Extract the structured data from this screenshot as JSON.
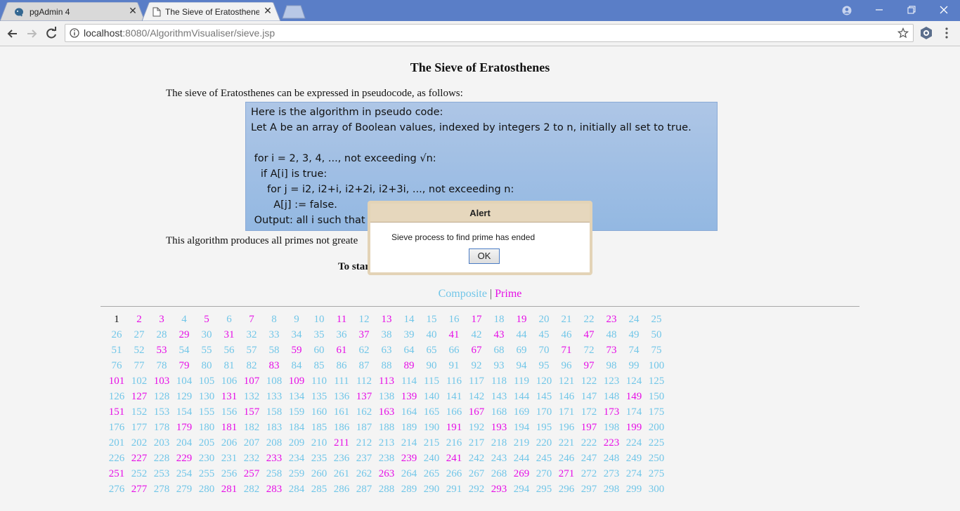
{
  "browser": {
    "tabs": [
      {
        "title": "pgAdmin 4",
        "active": false
      },
      {
        "title": "The Sieve of Eratosthenes",
        "active": true
      }
    ],
    "url_host": "localhost",
    "url_path": ":8080/AlgorithmVisualiser/sieve.jsp"
  },
  "page": {
    "title": "The Sieve of Eratosthenes",
    "intro": "The sieve of Eratosthenes can be expressed in pseudocode, as follows:",
    "code_lines": [
      "Here is the algorithm in pseudo code:",
      "Let A be an array of Boolean values, indexed by integers 2 to n, initially all set to true.",
      "",
      " for i = 2, 3, 4, ..., not exceeding √n:",
      "   if A[i] is true:",
      "     for j = i2, i2+i, i2+2i, i2+3i, ..., not exceeding n:",
      "       A[j] := false.",
      " Output: all i such that"
    ],
    "description": "This algorithm produces all primes not greate",
    "start_text": "To star",
    "legend_composite": "Composite",
    "legend_separator": "|",
    "legend_prime": "Prime"
  },
  "numbers": {
    "max": 300,
    "per_row": 25,
    "primes": [
      2,
      3,
      5,
      7,
      11,
      13,
      17,
      19,
      23,
      29,
      31,
      37,
      41,
      43,
      47,
      53,
      59,
      61,
      67,
      71,
      73,
      79,
      83,
      89,
      97,
      101,
      103,
      107,
      109,
      113,
      127,
      131,
      137,
      139,
      149,
      151,
      157,
      163,
      167,
      173,
      179,
      181,
      191,
      193,
      197,
      199,
      211,
      223,
      227,
      229,
      233,
      239,
      241,
      251,
      257,
      263,
      269,
      271,
      277,
      281,
      283,
      293
    ]
  },
  "colors": {
    "composite": "#71c6e8",
    "prime": "#e60ee6",
    "one": "#111111",
    "tabstrip": "#5a7ec7"
  },
  "alert": {
    "title": "Alert",
    "message": "Sieve process to find prime has ended",
    "ok_label": "OK"
  }
}
